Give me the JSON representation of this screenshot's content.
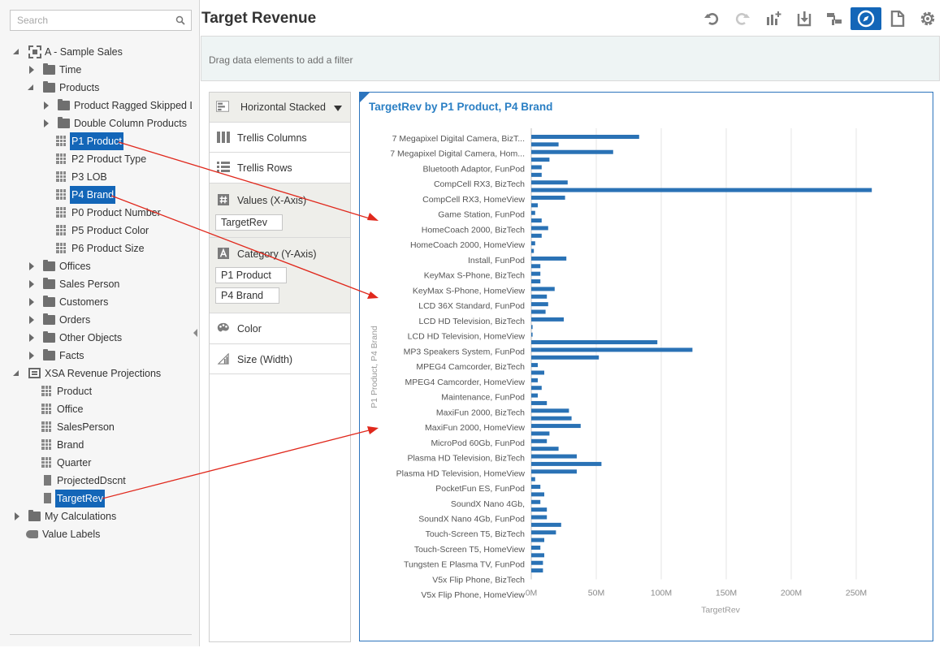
{
  "search": {
    "placeholder": "Search"
  },
  "tree": {
    "root_subject": "A - Sample Sales",
    "time": "Time",
    "products": "Products",
    "product_ragged": "Product Ragged Skipped L",
    "double_column": "Double Column Products",
    "p1": "P1 Product",
    "p2": "P2 Product Type",
    "p3": "P3 LOB",
    "p4": "P4 Brand",
    "p0": "P0 Product Number",
    "p5": "P5 Product Color",
    "p6": "P6 Product Size",
    "offices": "Offices",
    "sales_person": "Sales Person",
    "customers": "Customers",
    "orders": "Orders",
    "other_objects": "Other Objects",
    "facts": "Facts",
    "xsa": "XSA Revenue Projections",
    "x_product": "Product",
    "x_office": "Office",
    "x_salesperson": "SalesPerson",
    "x_brand": "Brand",
    "x_quarter": "Quarter",
    "x_projected": "ProjectedDscnt",
    "x_targetrev": "TargetRev",
    "my_calculations": "My Calculations",
    "value_labels": "Value Labels"
  },
  "header": {
    "title": "Target Revenue"
  },
  "toolbar_icons": [
    "undo-icon",
    "redo-icon",
    "add-visualization-icon",
    "export-icon",
    "data-diagram-icon",
    "explore-icon",
    "narrate-icon",
    "settings-icon"
  ],
  "filter_bar": {
    "hint": "Drag data elements to add a filter"
  },
  "grammar": {
    "chart_type": "Horizontal Stacked",
    "trellis_columns": "Trellis Columns",
    "trellis_rows": "Trellis Rows",
    "values_axis": "Values (X-Axis)",
    "values_item": "TargetRev",
    "category_axis": "Category (Y-Axis)",
    "category_items": [
      "P1 Product",
      "P4 Brand"
    ],
    "color": "Color",
    "size": "Size (Width)"
  },
  "colors": {
    "accent": "#1366b8",
    "bar": "#2a72b5",
    "annotation_arrow": "#e0281c"
  },
  "chart_data": {
    "type": "bar",
    "orientation": "horizontal",
    "title": "TargetRev by P1 Product, P4 Brand",
    "xlabel": "TargetRev",
    "ylabel": "P1 Product, P4 Brand",
    "xlim": [
      0,
      270
    ],
    "x_ticks": [
      "0M",
      "50M",
      "100M",
      "150M",
      "200M",
      "250M"
    ],
    "x_tick_values": [
      0,
      50,
      100,
      150,
      200,
      250
    ],
    "grid": true,
    "category_labels": [
      "7 Megapixel Digital Camera, BizT...",
      "7 Megapixel Digital Camera, Hom...",
      "Bluetooth Adaptor, FunPod",
      "CompCell RX3, BizTech",
      "CompCell RX3, HomeView",
      "Game Station, FunPod",
      "HomeCoach 2000, BizTech",
      "HomeCoach 2000, HomeView",
      "Install, FunPod",
      "KeyMax S-Phone, BizTech",
      "KeyMax S-Phone, HomeView",
      "LCD 36X Standard, FunPod",
      "LCD HD Television, BizTech",
      "LCD HD Television, HomeView",
      "MP3 Speakers System, FunPod",
      "MPEG4 Camcorder, BizTech",
      "MPEG4 Camcorder, HomeView",
      "Maintenance, FunPod",
      "MaxiFun 2000, BizTech",
      "MaxiFun 2000, HomeView",
      "MicroPod 60Gb, FunPod",
      "Plasma HD Television, BizTech",
      "Plasma HD Television, HomeView",
      "PocketFun ES, FunPod",
      "SoundX Nano 4Gb,",
      "SoundX Nano 4Gb, FunPod",
      "Touch-Screen T5, BizTech",
      "Touch-Screen T5, HomeView",
      "Tungsten E Plasma TV, FunPod",
      "V5x Flip Phone, BizTech",
      "V5x Flip Phone, HomeView"
    ],
    "values_millions": [
      83,
      21,
      63,
      14,
      8,
      8,
      28,
      262,
      26,
      5,
      3,
      8,
      13,
      8,
      3,
      2,
      27,
      7,
      7,
      7,
      18,
      12,
      13,
      11,
      25,
      1,
      1,
      97,
      124,
      52,
      5,
      10,
      5,
      8,
      5,
      12,
      29,
      31,
      38,
      14,
      12,
      21,
      35,
      54,
      35,
      3,
      7,
      10,
      7,
      12,
      12,
      23,
      19,
      10,
      7,
      10,
      9,
      9
    ]
  },
  "annotations": {
    "arrows": 3
  }
}
